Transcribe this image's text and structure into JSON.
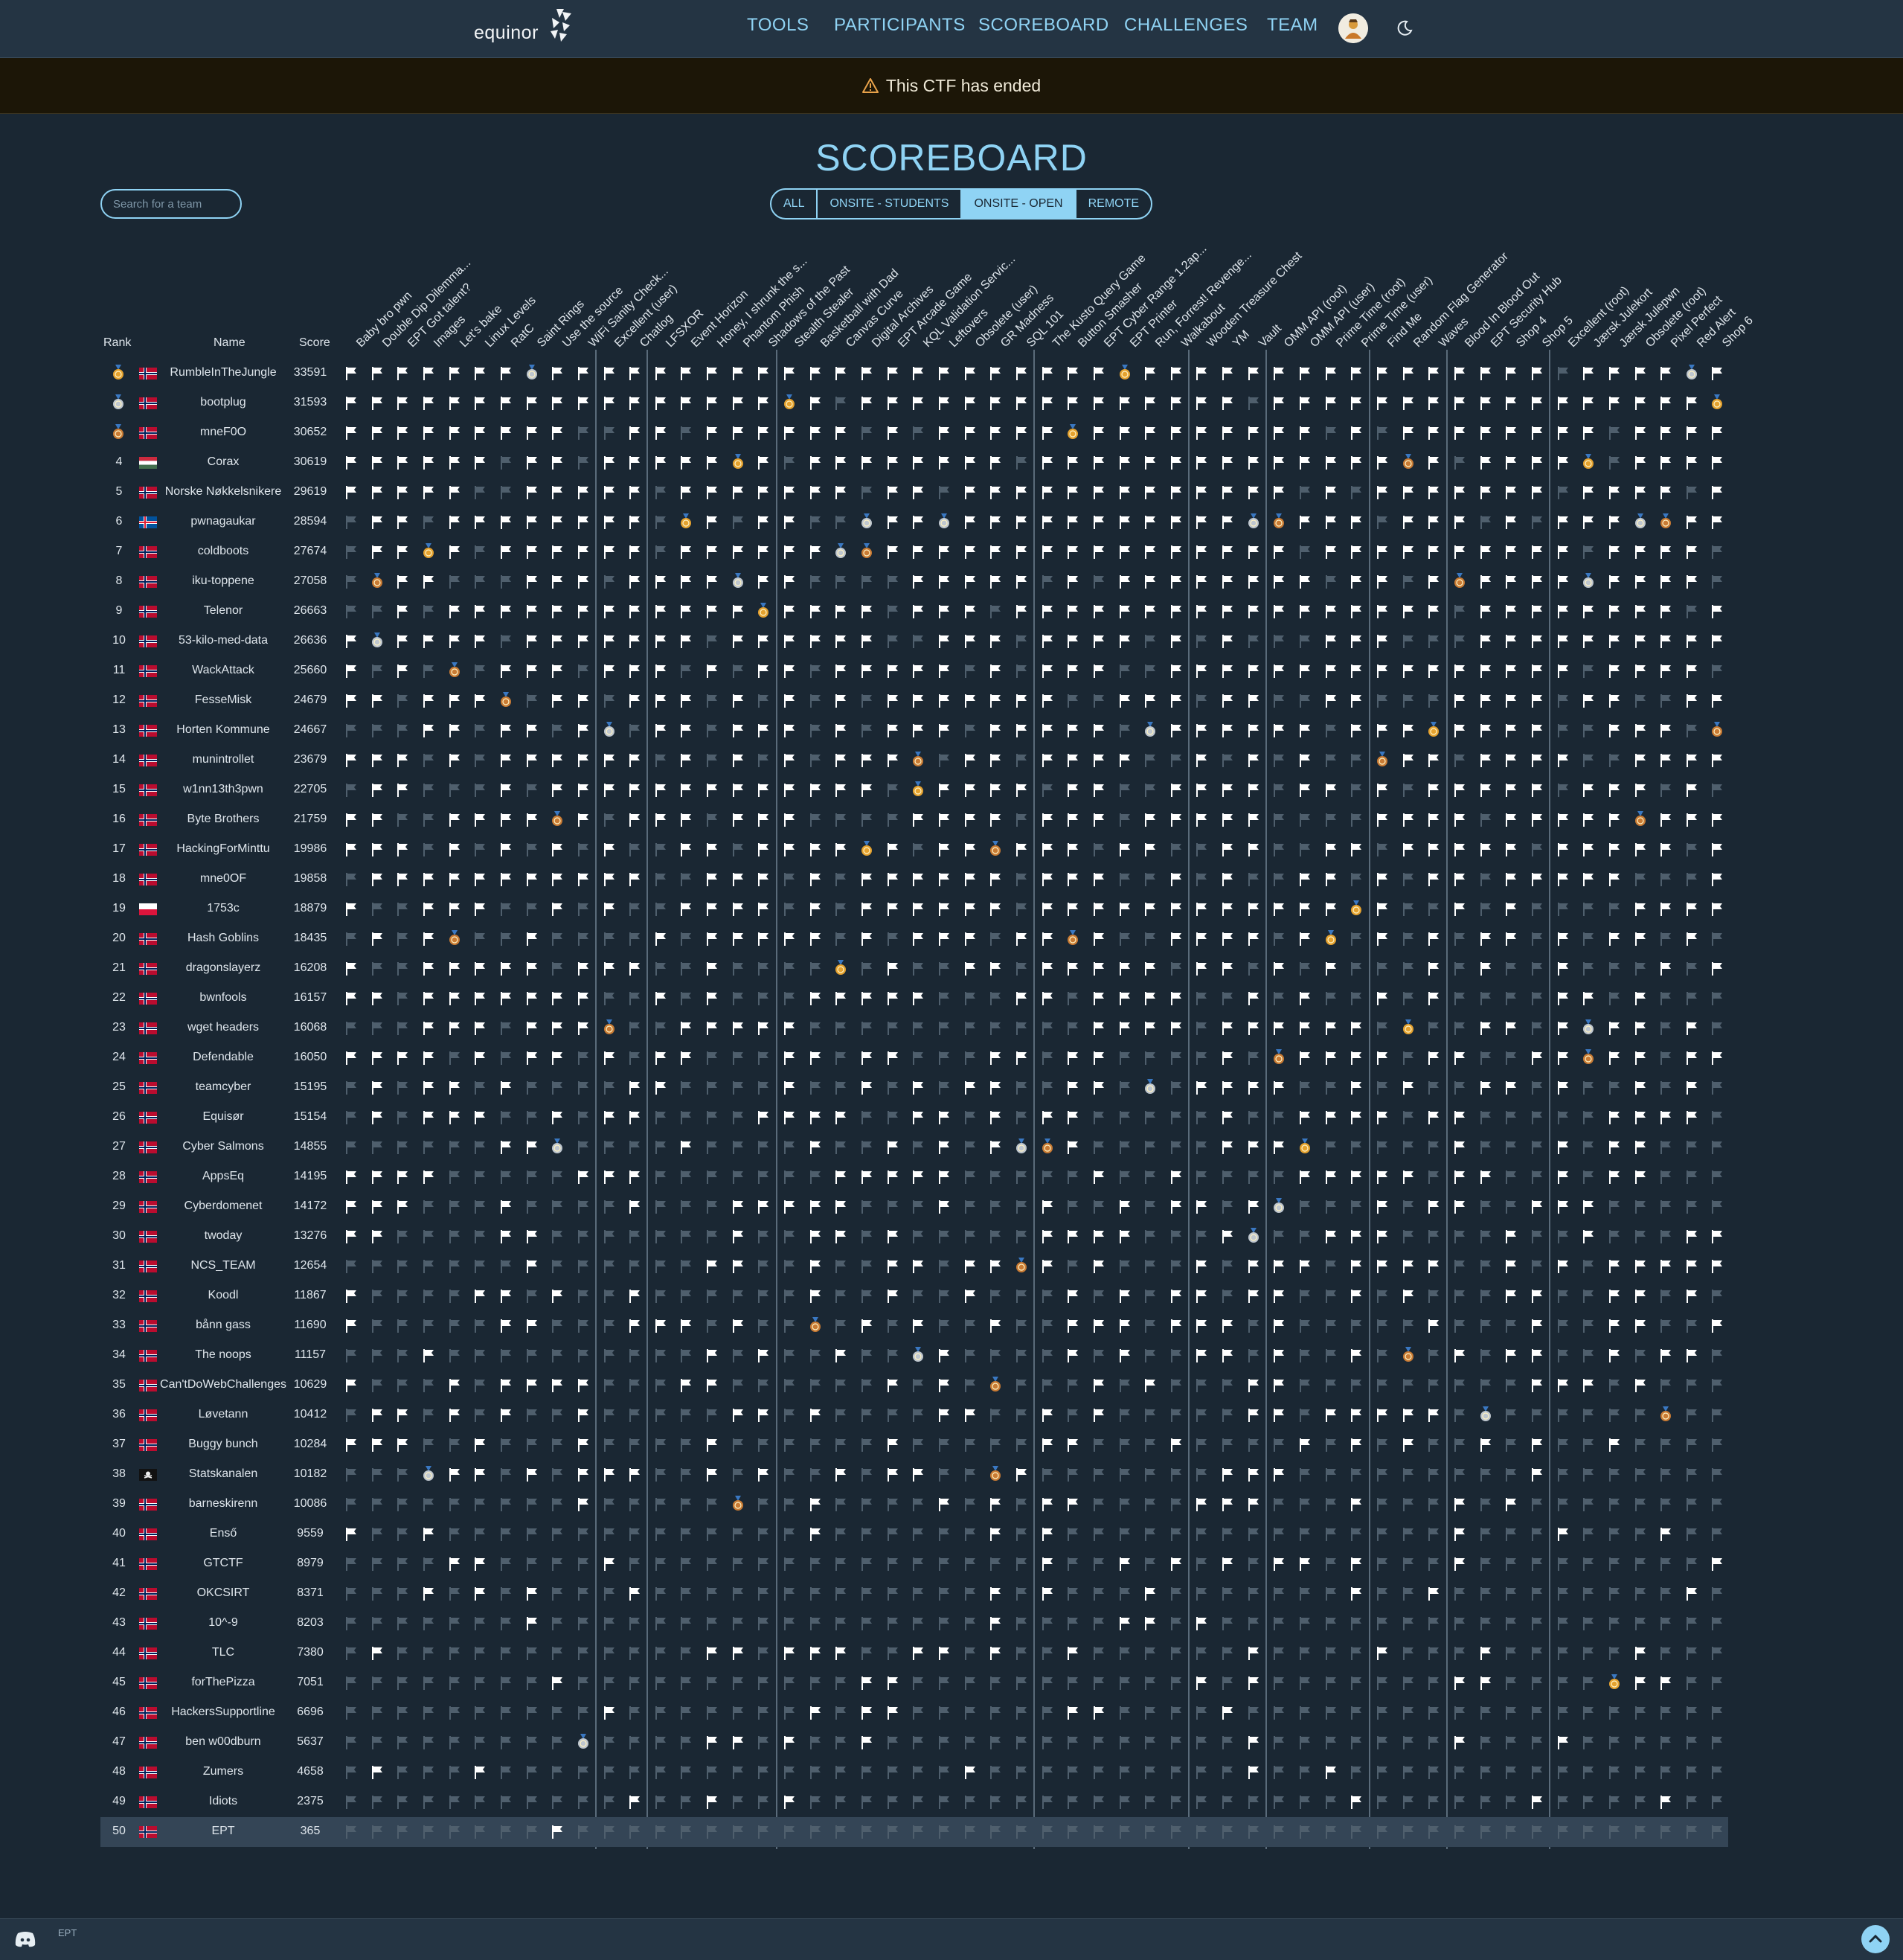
{
  "nav": {
    "brand": "equinor",
    "links": [
      "TOOLS",
      "PARTICIPANTS",
      "SCOREBOARD",
      "CHALLENGES",
      "TEAM"
    ],
    "theme_icon": "moon-icon"
  },
  "banner": {
    "text": "This CTF has ended"
  },
  "title": "SCOREBOARD",
  "search": {
    "placeholder": "Search for a team"
  },
  "filters": {
    "options": [
      "ALL",
      "ONSITE - STUDENTS",
      "ONSITE - OPEN",
      "REMOTE"
    ],
    "selected": "ONSITE - OPEN"
  },
  "table": {
    "headers": {
      "rank": "Rank",
      "name": "Name",
      "score": "Score"
    },
    "challenges": [
      "Baby bro pwn",
      "Double Dip Dilemma...",
      "EPT Got talent?",
      "Images",
      "Let's bake",
      "Linux Levels",
      "RatC",
      "Saint Rings",
      "Use the source",
      "WiFi Sanity Check...",
      "Excellent (user)",
      "Chatlog",
      "LFSXOR",
      "Event Horizon",
      "Honey, I shrunk the s...",
      "Phantom Phish",
      "Shadows of the Past",
      "Stealth Stealer",
      "Basketball with Dad",
      "Canvas Curve",
      "Digital Archives",
      "EPT Arcade Game",
      "KQL Validation Servic...",
      "Leftovers",
      "Obsolete (user)",
      "GR Madness",
      "SQL 101",
      "The Kusto Query Game",
      "Button Smasher",
      "EPT Cyber Range 1.2ap...",
      "EPT Printer",
      "Run, Forrest! Revenge...",
      "Walkabout",
      "Wooden Treasure Chest",
      "YM",
      "Vault",
      "OMM API (root)",
      "OMM API (user)",
      "Prime Time (root)",
      "Prime Time (user)",
      "Find Me",
      "Random Flag Generator",
      "Waves",
      "Blood In Blood Out",
      "EPT Security Hub",
      "Shop 4",
      "Shop 5",
      "Excellent (root)",
      "Jærsk Julekort",
      "Jærsk Julepwn",
      "Obsolete (root)",
      "Pixel Perfect",
      "Red Alert",
      "Shop 6"
    ],
    "teams": [
      {
        "rank": 1,
        "name": "RumbleInTheJungle",
        "score": 33591,
        "country": "no"
      },
      {
        "rank": 2,
        "name": "bootplug",
        "score": 31593,
        "country": "no"
      },
      {
        "rank": 3,
        "name": "mneF0O",
        "score": 30652,
        "country": "no"
      },
      {
        "rank": 4,
        "name": "Corax",
        "score": 30619,
        "country": "hu"
      },
      {
        "rank": 5,
        "name": "Norske Nøkkelsnikere",
        "score": 29619,
        "country": "no"
      },
      {
        "rank": 6,
        "name": "pwnagaukar",
        "score": 28594,
        "country": "is"
      },
      {
        "rank": 7,
        "name": "coldboots",
        "score": 27674,
        "country": "no"
      },
      {
        "rank": 8,
        "name": "iku-toppene",
        "score": 27058,
        "country": "no"
      },
      {
        "rank": 9,
        "name": "Telenor",
        "score": 26663,
        "country": "no"
      },
      {
        "rank": 10,
        "name": "53-kilo-med-data",
        "score": 26636,
        "country": "no"
      },
      {
        "rank": 11,
        "name": "WackAttack",
        "score": 25660,
        "country": "no"
      },
      {
        "rank": 12,
        "name": "FesseMisk",
        "score": 24679,
        "country": "no"
      },
      {
        "rank": 13,
        "name": "Horten Kommune",
        "score": 24667,
        "country": "no"
      },
      {
        "rank": 14,
        "name": "munintrollet",
        "score": 23679,
        "country": "no"
      },
      {
        "rank": 15,
        "name": "w1nn13th3pwn",
        "score": 22705,
        "country": "no"
      },
      {
        "rank": 16,
        "name": "Byte Brothers",
        "score": 21759,
        "country": "no"
      },
      {
        "rank": 17,
        "name": "HackingForMinttu",
        "score": 19986,
        "country": "no"
      },
      {
        "rank": 18,
        "name": "mne0OF",
        "score": 19858,
        "country": "no"
      },
      {
        "rank": 19,
        "name": "1753c",
        "score": 18879,
        "country": "pl"
      },
      {
        "rank": 20,
        "name": "Hash Goblins",
        "score": 18435,
        "country": "no"
      },
      {
        "rank": 21,
        "name": "dragonslayerz",
        "score": 16208,
        "country": "no"
      },
      {
        "rank": 22,
        "name": "bwnfools",
        "score": 16157,
        "country": "no"
      },
      {
        "rank": 23,
        "name": "wget headers",
        "score": 16068,
        "country": "no"
      },
      {
        "rank": 24,
        "name": "Defendable",
        "score": 16050,
        "country": "no"
      },
      {
        "rank": 25,
        "name": "teamcyber",
        "score": 15195,
        "country": "no"
      },
      {
        "rank": 26,
        "name": "Equisør",
        "score": 15154,
        "country": "no"
      },
      {
        "rank": 27,
        "name": "Cyber Salmons",
        "score": 14855,
        "country": "no"
      },
      {
        "rank": 28,
        "name": "AppsEq",
        "score": 14195,
        "country": "no"
      },
      {
        "rank": 29,
        "name": "Cyberdomenet",
        "score": 14172,
        "country": "no"
      },
      {
        "rank": 30,
        "name": "twoday",
        "score": 13276,
        "country": "no"
      },
      {
        "rank": 31,
        "name": "NCS_TEAM",
        "score": 12654,
        "country": "no"
      },
      {
        "rank": 32,
        "name": "Koodl",
        "score": 11867,
        "country": "no"
      },
      {
        "rank": 33,
        "name": "bånn gass",
        "score": 11690,
        "country": "no"
      },
      {
        "rank": 34,
        "name": "The noops",
        "score": 11157,
        "country": "no"
      },
      {
        "rank": 35,
        "name": "Can'tDoWebChallenges",
        "score": 10629,
        "country": "no"
      },
      {
        "rank": 36,
        "name": "Løvetann",
        "score": 10412,
        "country": "no"
      },
      {
        "rank": 37,
        "name": "Buggy bunch",
        "score": 10284,
        "country": "no"
      },
      {
        "rank": 38,
        "name": "Statskanalen",
        "score": 10182,
        "country": "pirate"
      },
      {
        "rank": 39,
        "name": "barneskirenn",
        "score": 10086,
        "country": "no"
      },
      {
        "rank": 40,
        "name": "Enső",
        "score": 9559,
        "country": "no"
      },
      {
        "rank": 41,
        "name": "GTCTF",
        "score": 8979,
        "country": "no"
      },
      {
        "rank": 42,
        "name": "OKCSIRT",
        "score": 8371,
        "country": "no"
      },
      {
        "rank": 43,
        "name": "10^-9",
        "score": 8203,
        "country": "no"
      },
      {
        "rank": 44,
        "name": "TLC",
        "score": 7380,
        "country": "no"
      },
      {
        "rank": 45,
        "name": "forThePizza",
        "score": 7051,
        "country": "no"
      },
      {
        "rank": 46,
        "name": "HackersSupportline",
        "score": 6696,
        "country": "no"
      },
      {
        "rank": 47,
        "name": "ben w00dburn",
        "score": 5637,
        "country": "no"
      },
      {
        "rank": 48,
        "name": "Zumers",
        "score": 4658,
        "country": "no"
      },
      {
        "rank": 49,
        "name": "Idiots",
        "score": 2375,
        "country": "no"
      },
      {
        "rank": 50,
        "name": "EPT",
        "score": 365,
        "country": "no"
      }
    ],
    "highlighted_team": "EPT",
    "solve_legend": {
      "solved": "white-flag-icon",
      "unsolved": "grey-flag-icon",
      "first_blood": "medal-icon"
    }
  },
  "colors": {
    "accent": "#8fd3f4",
    "background": "#1a2733",
    "nav": "#243443",
    "banner": "#1c1607",
    "highlight_row": "#344556"
  },
  "footer": {
    "discord_icon": "discord-icon",
    "ept_logo": "EPT",
    "scroll_top_icon": "chevron-up-icon"
  }
}
